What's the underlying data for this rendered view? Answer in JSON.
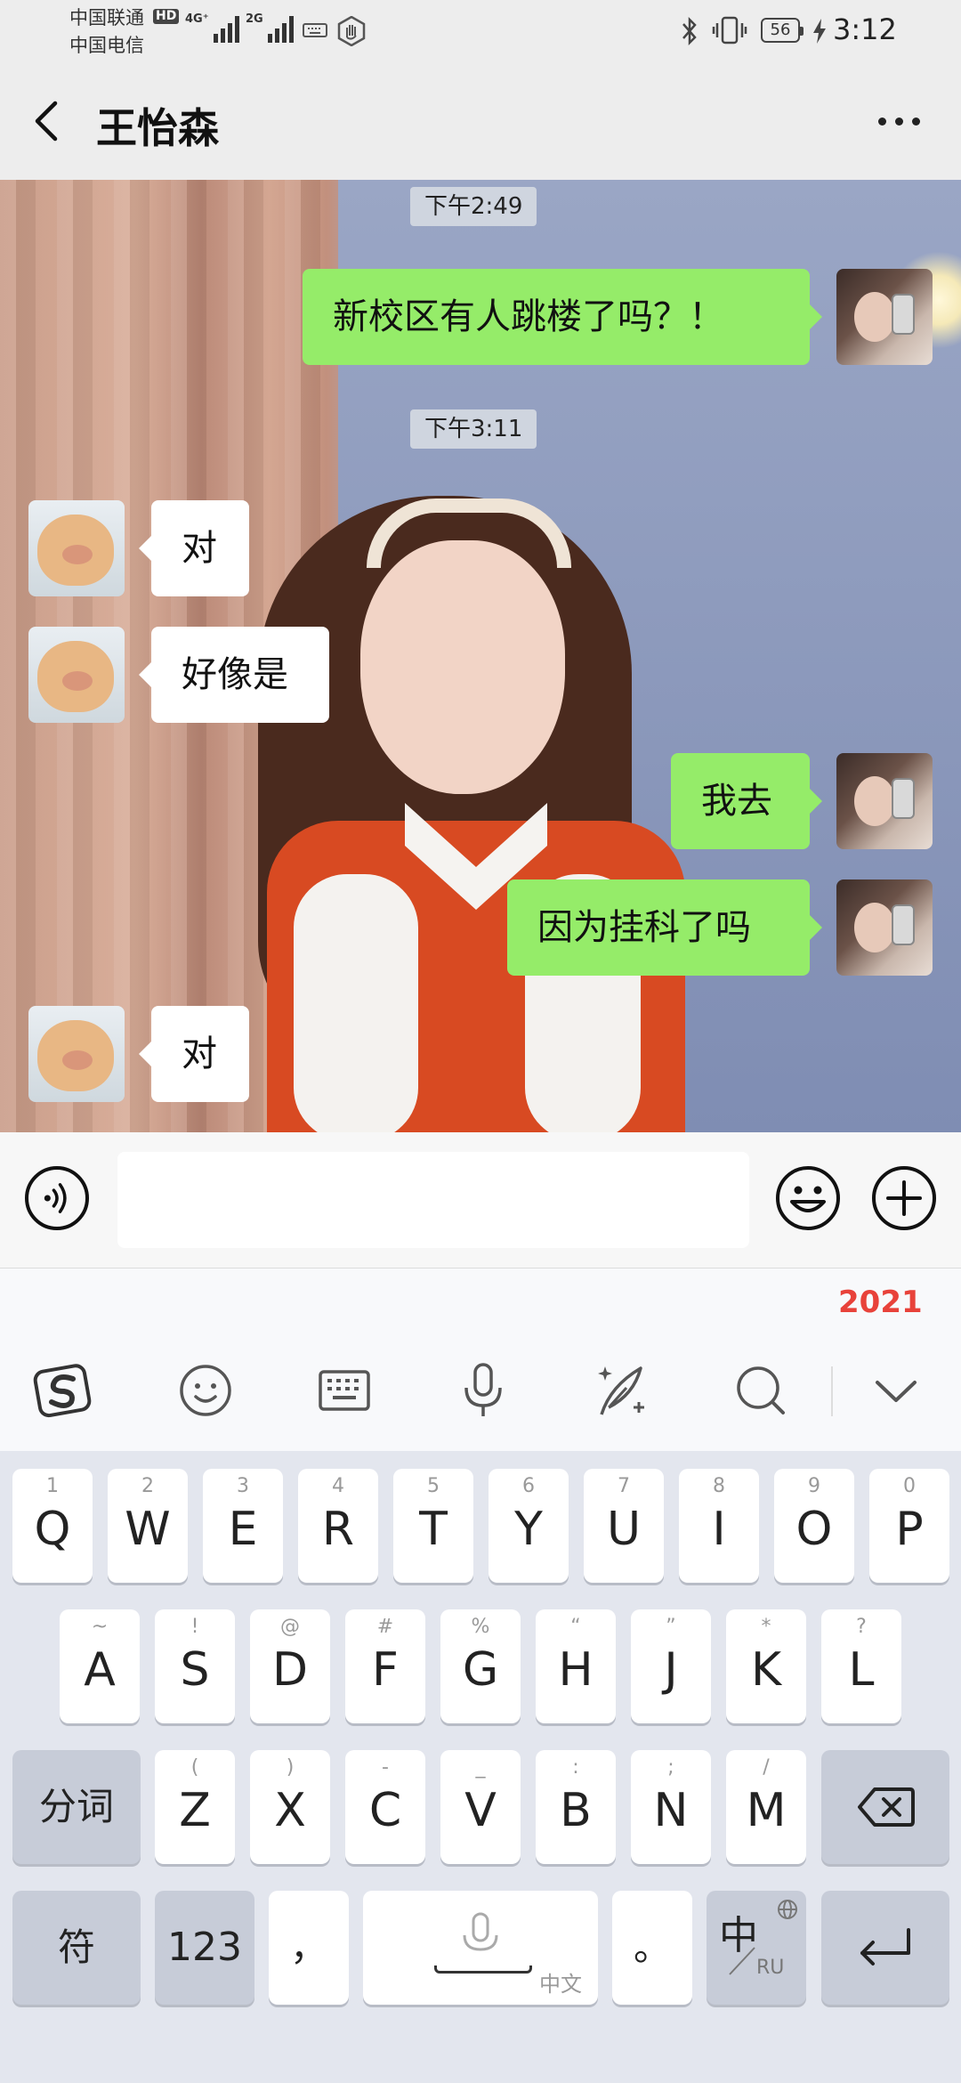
{
  "status_bar": {
    "carrier_1": "中国联通",
    "carrier_2": "中国电信",
    "hd": "HD",
    "net_1": "4G⁺",
    "net_2": "2G",
    "battery": "56",
    "time": "3:12"
  },
  "header": {
    "title": "王怡森"
  },
  "messages": [
    {
      "type": "time",
      "text": "下午2:49"
    },
    {
      "type": "sent",
      "text": "新校区有人跳楼了吗？！"
    },
    {
      "type": "time",
      "text": "下午3:11"
    },
    {
      "type": "received",
      "text": "对"
    },
    {
      "type": "received",
      "text": "好像是"
    },
    {
      "type": "sent",
      "text": "我去"
    },
    {
      "type": "sent",
      "text": "因为挂科了吗"
    },
    {
      "type": "received",
      "text": "对"
    }
  ],
  "input": {
    "placeholder": ""
  },
  "keyboard": {
    "badge": "2021",
    "tools": [
      "sogou-logo-icon",
      "emoji-icon",
      "keyboard-icon",
      "microphone-icon",
      "handwriting-icon",
      "search-icon",
      "chevron-down-icon"
    ],
    "row1": [
      {
        "sub": "1",
        "key": "Q"
      },
      {
        "sub": "2",
        "key": "W"
      },
      {
        "sub": "3",
        "key": "E"
      },
      {
        "sub": "4",
        "key": "R"
      },
      {
        "sub": "5",
        "key": "T"
      },
      {
        "sub": "6",
        "key": "Y"
      },
      {
        "sub": "7",
        "key": "U"
      },
      {
        "sub": "8",
        "key": "I"
      },
      {
        "sub": "9",
        "key": "O"
      },
      {
        "sub": "0",
        "key": "P"
      }
    ],
    "row2": [
      {
        "sub": "~",
        "key": "A"
      },
      {
        "sub": "!",
        "key": "S"
      },
      {
        "sub": "@",
        "key": "D"
      },
      {
        "sub": "#",
        "key": "F"
      },
      {
        "sub": "%",
        "key": "G"
      },
      {
        "sub": "“",
        "key": "H"
      },
      {
        "sub": "”",
        "key": "J"
      },
      {
        "sub": "*",
        "key": "K"
      },
      {
        "sub": "?",
        "key": "L"
      }
    ],
    "row3": [
      {
        "sub": "(",
        "key": "Z"
      },
      {
        "sub": ")",
        "key": "X"
      },
      {
        "sub": "-",
        "key": "C"
      },
      {
        "sub": "_",
        "key": "V"
      },
      {
        "sub": ":",
        "key": "B"
      },
      {
        "sub": ";",
        "key": "N"
      },
      {
        "sub": "/",
        "key": "M"
      }
    ],
    "fenci": "分词",
    "fu": "符",
    "num": "123",
    "comma": "，",
    "space_label": "中文",
    "period": "。",
    "lang_main": "中",
    "lang_sub": "RU"
  }
}
